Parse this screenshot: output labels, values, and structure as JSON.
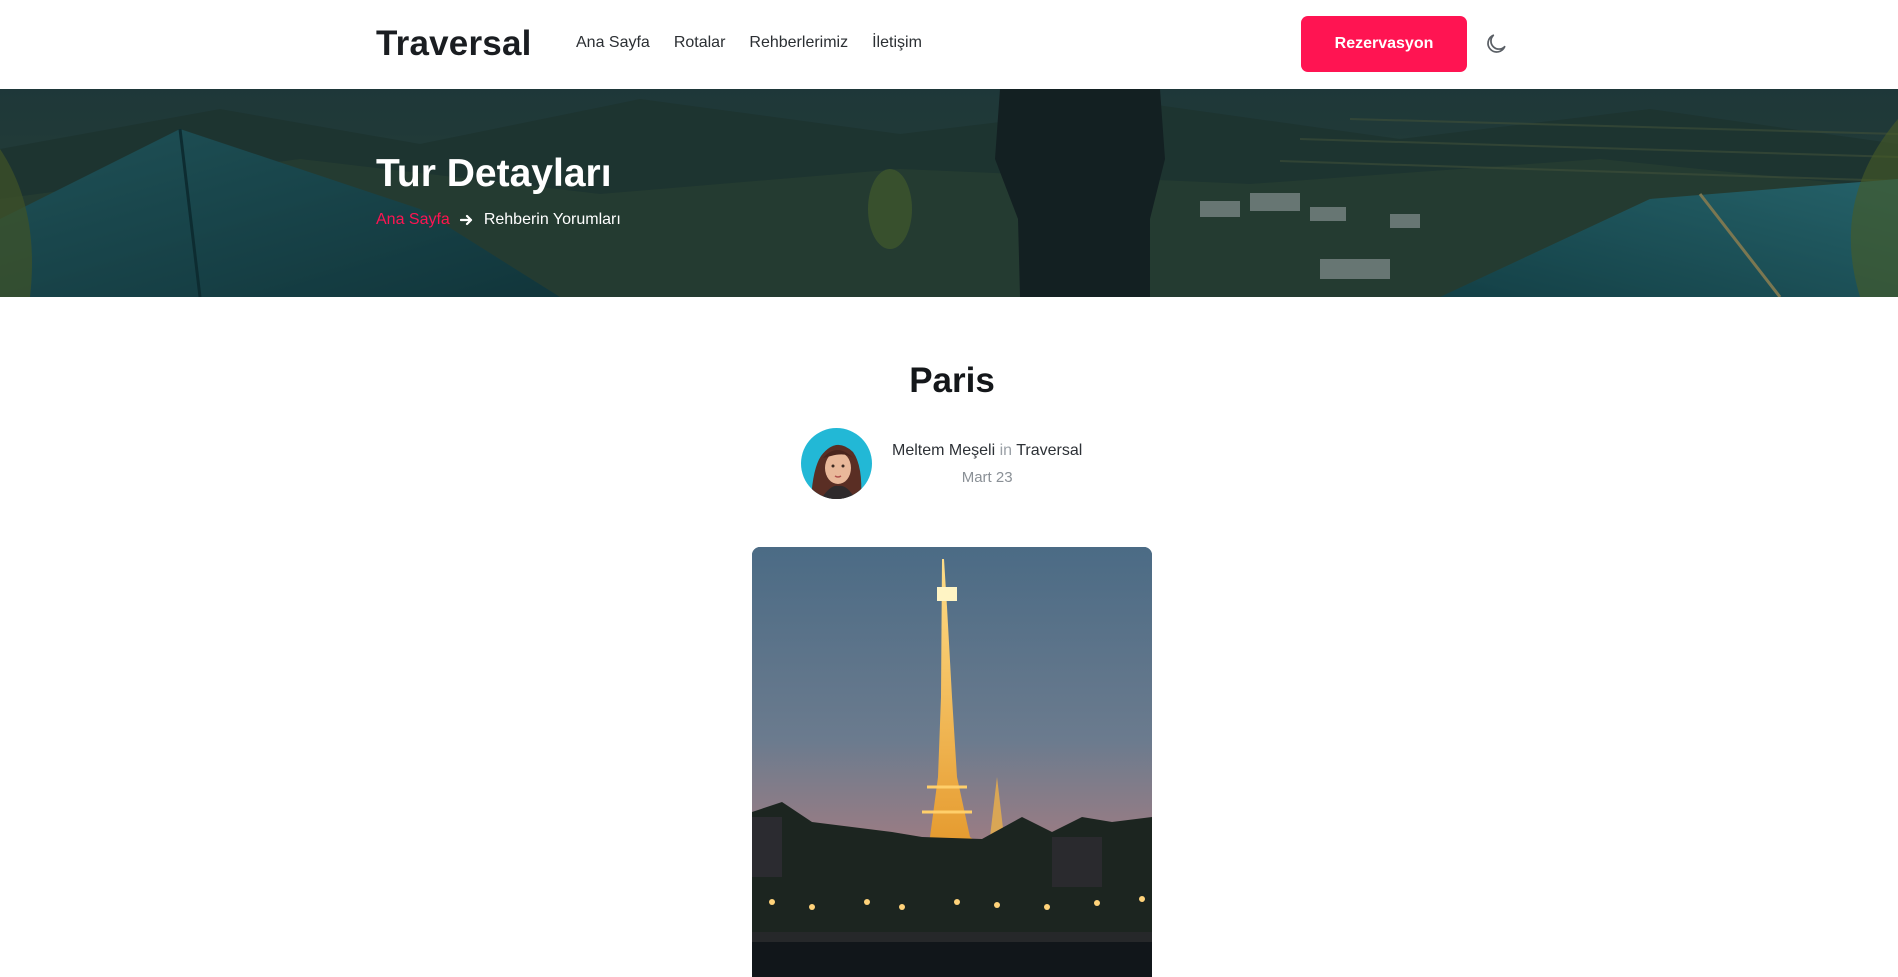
{
  "navbar": {
    "brand": "Traversal",
    "links": [
      "Ana Sayfa",
      "Rotalar",
      "Rehberlerimiz",
      "İletişim"
    ],
    "cta_label": "Rezervasyon",
    "theme_icon": "moon-icon"
  },
  "hero": {
    "title": "Tur Detayları",
    "breadcrumb": {
      "home": "Ana Sayfa",
      "separator_icon": "arrow-right-icon",
      "current": "Rehberin Yorumları"
    }
  },
  "post": {
    "title": "Paris",
    "author": "Meltem Meşeli",
    "connector": "in",
    "site": "Traversal",
    "date": "Mart 23",
    "image_icon": "eiffel-tower-photo"
  },
  "colors": {
    "accent": "#ff1452",
    "text": "#1c1f23",
    "muted": "#8a9096"
  }
}
